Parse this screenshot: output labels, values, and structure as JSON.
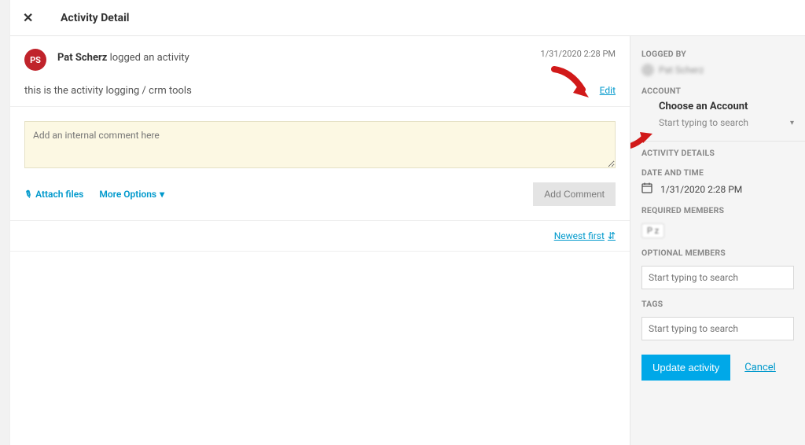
{
  "header": {
    "title": "Activity Detail"
  },
  "activity": {
    "avatar_initials": "PS",
    "author": "Pat Scherz",
    "action_text": " logged an activity",
    "timestamp": "1/31/2020 2:28 PM",
    "description": "this is the activity logging / crm tools",
    "edit_label": "Edit"
  },
  "comment": {
    "placeholder": "Add an internal comment here",
    "attach_label": "Attach files",
    "more_options_label": "More Options",
    "add_button_label": "Add Comment"
  },
  "sort": {
    "label": "Newest first"
  },
  "sidebar": {
    "logged_by_label": "LOGGED BY",
    "logged_by_name": "Pat Scherz",
    "account_label": "ACCOUNT",
    "choose_account": "Choose an Account",
    "account_search_placeholder": "Start typing to search",
    "activity_details_label": "ACTIVITY DETAILS",
    "date_time_label": "DATE AND TIME",
    "date_time_value": "1/31/2020 2:28 PM",
    "required_members_label": "REQUIRED MEMBERS",
    "required_member_chip": "P          z",
    "optional_members_label": "OPTIONAL MEMBERS",
    "optional_members_placeholder": "Start typing to search",
    "tags_label": "TAGS",
    "tags_placeholder": "Start typing to search",
    "update_label": "Update activity",
    "cancel_label": "Cancel"
  }
}
